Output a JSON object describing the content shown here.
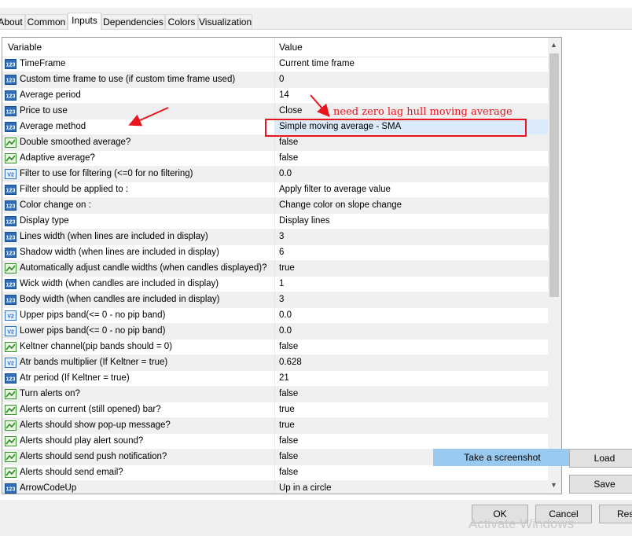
{
  "tabs": [
    "About",
    "Common",
    "Inputs",
    "Dependencies",
    "Colors",
    "Visualization"
  ],
  "active_tab": "Inputs",
  "grid": {
    "headers": {
      "variable": "Variable",
      "value": "Value"
    },
    "rows": [
      {
        "icon": "123",
        "name": "TimeFrame",
        "value": "Current time frame"
      },
      {
        "icon": "123",
        "name": "Custom time frame to use (if custom time frame used)",
        "value": "0"
      },
      {
        "icon": "123",
        "name": "Average period",
        "value": "14"
      },
      {
        "icon": "123",
        "name": "Price to use",
        "value": "Close"
      },
      {
        "icon": "123",
        "name": "Average method",
        "value": "Simple moving average - SMA"
      },
      {
        "icon": "bool",
        "name": "Double smoothed average?",
        "value": "false"
      },
      {
        "icon": "bool",
        "name": "Adaptive average?",
        "value": "false"
      },
      {
        "icon": "double",
        "name": "Filter to use for filtering (<=0 for no filtering)",
        "value": "0.0"
      },
      {
        "icon": "123",
        "name": "Filter should be applied to :",
        "value": "Apply filter to average value"
      },
      {
        "icon": "123",
        "name": "Color change on :",
        "value": "Change color on slope change"
      },
      {
        "icon": "123",
        "name": "Display type",
        "value": "Display lines"
      },
      {
        "icon": "123",
        "name": "Lines width (when lines are included in display)",
        "value": "3"
      },
      {
        "icon": "123",
        "name": "Shadow width (when lines are included in display)",
        "value": "6"
      },
      {
        "icon": "bool",
        "name": "Automatically adjust candle widths (when candles displayed)?",
        "value": "true"
      },
      {
        "icon": "123",
        "name": "Wick width (when candles are included in display)",
        "value": "1"
      },
      {
        "icon": "123",
        "name": "Body width (when candles are included in display)",
        "value": "3"
      },
      {
        "icon": "double",
        "name": "Upper pips band(<= 0 - no pip band)",
        "value": "0.0"
      },
      {
        "icon": "double",
        "name": "Lower pips band(<= 0 - no pip band)",
        "value": "0.0"
      },
      {
        "icon": "bool",
        "name": "Keltner channel(pip bands should = 0)",
        "value": "false"
      },
      {
        "icon": "double",
        "name": "Atr bands multiplier (If Keltner = true)",
        "value": "0.628"
      },
      {
        "icon": "123",
        "name": "Atr period (If Keltner = true)",
        "value": "21"
      },
      {
        "icon": "bool",
        "name": "Turn alerts on?",
        "value": "false"
      },
      {
        "icon": "bool",
        "name": "Alerts on current (still opened) bar?",
        "value": "true"
      },
      {
        "icon": "bool",
        "name": "Alerts should show pop-up message?",
        "value": "true"
      },
      {
        "icon": "bool",
        "name": "Alerts should play alert sound?",
        "value": "false"
      },
      {
        "icon": "bool",
        "name": "Alerts should send push notification?",
        "value": "false"
      },
      {
        "icon": "bool",
        "name": "Alerts should send email?",
        "value": "false"
      },
      {
        "icon": "123",
        "name": "ArrowCodeUp",
        "value": "Up in a circle"
      }
    ]
  },
  "annotation": {
    "note": "need zero lag hull moving average",
    "color": "#e8141e"
  },
  "buttons": {
    "take_screenshot": "Take a screenshot",
    "load": "Load",
    "save": "Save",
    "ok": "OK",
    "cancel": "Cancel",
    "reset": "Rese"
  },
  "watermark": "Activate Windows",
  "colors": {
    "selected_row": "#dcebfc",
    "alt_row": "#efefef",
    "screenshot_bg": "#99c9ef"
  }
}
